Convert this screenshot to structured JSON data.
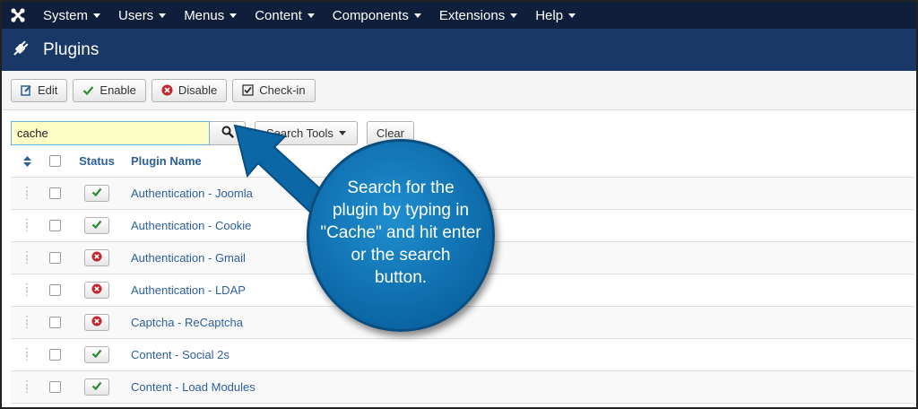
{
  "menubar": {
    "items": [
      {
        "label": "System"
      },
      {
        "label": "Users"
      },
      {
        "label": "Menus"
      },
      {
        "label": "Content"
      },
      {
        "label": "Components"
      },
      {
        "label": "Extensions"
      },
      {
        "label": "Help"
      }
    ]
  },
  "header": {
    "title": "Plugins"
  },
  "toolbar": {
    "edit_label": "Edit",
    "enable_label": "Enable",
    "disable_label": "Disable",
    "checkin_label": "Check-in"
  },
  "search": {
    "value": "cache",
    "tools_label": "Search Tools",
    "clear_label": "Clear"
  },
  "table": {
    "headers": {
      "status": "Status",
      "name": "Plugin Name"
    },
    "rows": [
      {
        "name": "Authentication - Joomla",
        "status": "enabled"
      },
      {
        "name": "Authentication - Cookie",
        "status": "enabled"
      },
      {
        "name": "Authentication - Gmail",
        "status": "disabled"
      },
      {
        "name": "Authentication - LDAP",
        "status": "disabled"
      },
      {
        "name": "Captcha - ReCaptcha",
        "status": "disabled"
      },
      {
        "name": "Content - Social 2s",
        "status": "enabled"
      },
      {
        "name": "Content - Load Modules",
        "status": "enabled"
      }
    ]
  },
  "annotation": {
    "lines": [
      "Search for the",
      "plugin by typing in",
      "\"Cache\" and hit enter",
      "or the search",
      "button."
    ]
  },
  "colors": {
    "menubar": "#0f1e3a",
    "titlebar": "#1a3867",
    "link": "#2b5f9e",
    "enabled": "#2e8b2e",
    "disabled": "#c0272d",
    "callout": "#0c67a6"
  }
}
